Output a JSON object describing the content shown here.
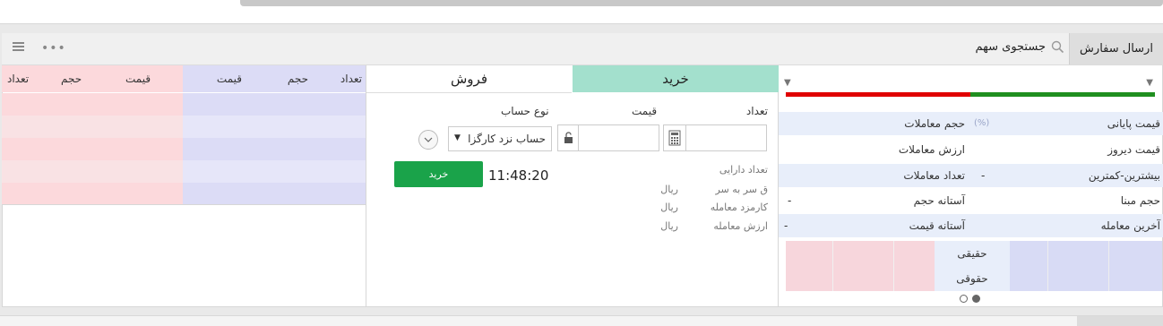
{
  "header": {
    "send_order_tab": "ارسال سفارش",
    "search_label": "جستجوی سهم",
    "more": "•••"
  },
  "stats": {
    "rows": [
      {
        "label_right": "قیمت پایانی",
        "badge": "(%)",
        "label_left": "حجم معاملات",
        "value_left": ""
      },
      {
        "label_right": "قیمت دیروز",
        "badge": "",
        "label_left": "ارزش معاملات",
        "value_left": ""
      },
      {
        "label_right": "بیشترین-کمترین",
        "badge": "-",
        "label_left": "تعداد معاملات",
        "value_left": ""
      },
      {
        "label_right": "حجم مبنا",
        "badge": "",
        "label_left": "آستانه حجم",
        "value_left": "-"
      },
      {
        "label_right": "آخرین معامله",
        "badge": "",
        "label_left": "آستانه قیمت",
        "value_left": "-"
      }
    ],
    "mini_labels": [
      "حقیقی",
      "حقوقی"
    ]
  },
  "order": {
    "tab_buy": "خرید",
    "tab_sell": "فروش",
    "field_qty": "تعداد",
    "field_price": "قیمت",
    "field_account": "نوع حساب",
    "account_value": "حساب نزد کارگزا",
    "time": "11:48:20",
    "buy_button": "خرید",
    "info": [
      {
        "label": "تعداد دارایی",
        "unit": ""
      },
      {
        "label": "ق سر به سر",
        "unit": "ریال"
      },
      {
        "label": "کارمزد معامله",
        "unit": "ریال"
      },
      {
        "label": "ارزش معامله",
        "unit": "ریال"
      }
    ]
  },
  "book": {
    "buy_headers": [
      "تعداد",
      "حجم",
      "قیمت"
    ],
    "sell_headers": [
      "قیمت",
      "حجم",
      "تعداد"
    ]
  },
  "colors": {
    "buy_tab": "#a3e0cd",
    "buy_button": "#1aa34a",
    "book_blue": "#dcdcf6",
    "book_red": "#fcd9dc"
  }
}
